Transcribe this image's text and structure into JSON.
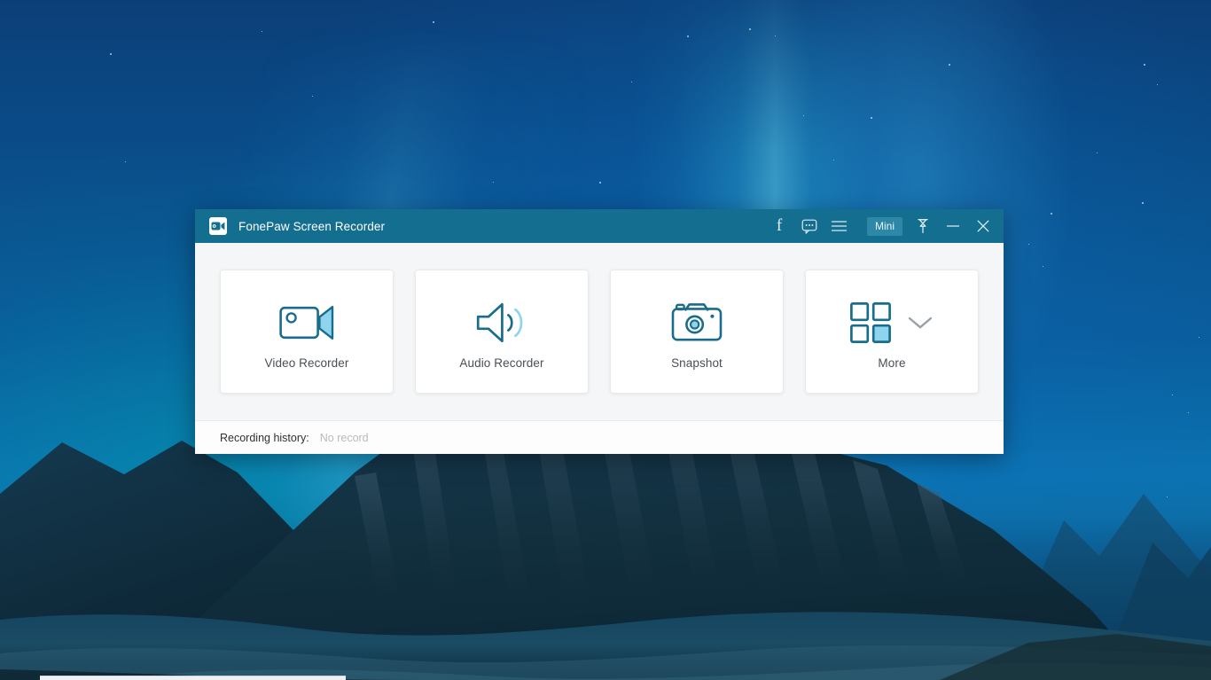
{
  "window": {
    "title": "FonePaw Screen Recorder",
    "app_icon": "video-camera-icon",
    "titlebar_color": "#136e90",
    "accent_color": "#1a6f8e",
    "accent_light": "#8ed4ef"
  },
  "titlebar_actions": [
    {
      "name": "facebook",
      "label": "f",
      "icon": "facebook-icon"
    },
    {
      "name": "feedback",
      "label": "",
      "icon": "speech-bubble-icon"
    },
    {
      "name": "menu",
      "label": "",
      "icon": "hamburger-menu-icon"
    }
  ],
  "titlebar_controls": {
    "mini_label": "Mini",
    "pin_icon": "pushpin-icon",
    "minimize_icon": "minimize-icon",
    "close_icon": "close-icon"
  },
  "main": {
    "cards": [
      {
        "id": "video-recorder",
        "label": "Video Recorder",
        "icon": "camcorder-icon"
      },
      {
        "id": "audio-recorder",
        "label": "Audio Recorder",
        "icon": "speaker-waves-icon"
      },
      {
        "id": "snapshot",
        "label": "Snapshot",
        "icon": "camera-icon"
      },
      {
        "id": "more",
        "label": "More",
        "icon": "grid-squares-icon",
        "has_chevron": true
      }
    ]
  },
  "footer": {
    "history_label": "Recording history:",
    "history_value": "No record"
  }
}
